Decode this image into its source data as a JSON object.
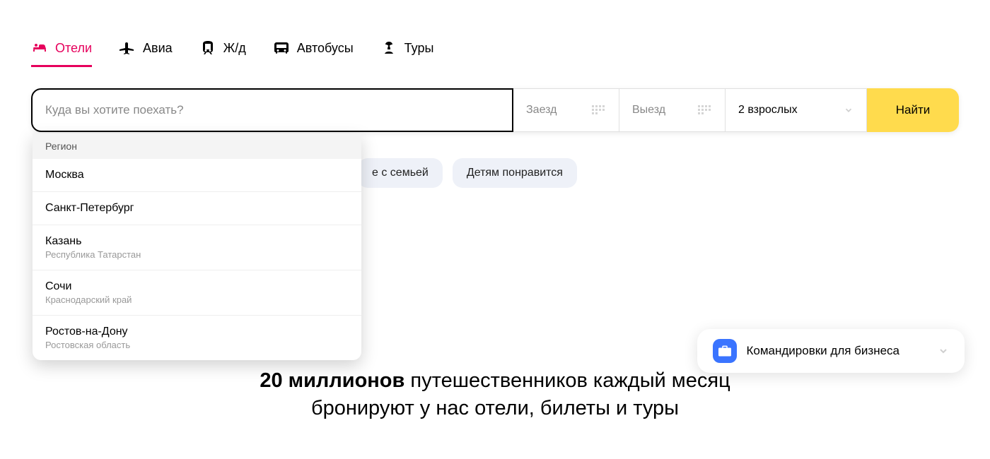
{
  "tabs": [
    {
      "label": "Отели",
      "icon": "hotel",
      "active": true
    },
    {
      "label": "Авиа",
      "icon": "plane",
      "active": false
    },
    {
      "label": "Ж/д",
      "icon": "train",
      "active": false
    },
    {
      "label": "Автобусы",
      "icon": "bus",
      "active": false
    },
    {
      "label": "Туры",
      "icon": "palm",
      "active": false
    }
  ],
  "search": {
    "destination_placeholder": "Куда вы хотите поехать?",
    "checkin_label": "Заезд",
    "checkout_label": "Выезд",
    "guests_label": "2 взрослых",
    "submit_label": "Найти"
  },
  "suggestions": {
    "header": "Регион",
    "items": [
      {
        "name": "Москва",
        "sub": ""
      },
      {
        "name": "Санкт-Петербург",
        "sub": ""
      },
      {
        "name": "Казань",
        "sub": "Республика Татарстан"
      },
      {
        "name": "Сочи",
        "sub": "Краснодарский край"
      },
      {
        "name": "Ростов-на-Дону",
        "sub": "Ростовская область"
      }
    ]
  },
  "chips": [
    "е с семьей",
    "Детям понравится"
  ],
  "promo": {
    "bold": "20 миллионов",
    "line1_rest": " путешественников каждый месяц",
    "line2": "бронируют у нас отели, билеты и туры"
  },
  "biz": {
    "label": "Командировки для бизнеса"
  },
  "colors": {
    "accent": "#E6005C",
    "button": "#FFDB4D",
    "chip_bg": "#EEF1F8",
    "biz_icon": "#3a74ff"
  }
}
